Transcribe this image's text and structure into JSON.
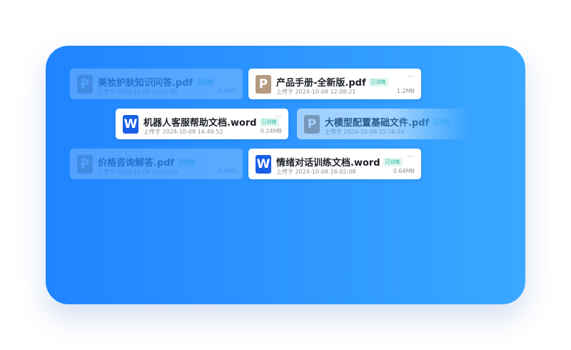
{
  "cards": [
    {
      "name": "美妆护肤知识问答.pdf",
      "badge": "已训练",
      "uploaded": "上传于 2024-10-08 12:32:46",
      "size": "0.8MB",
      "icon_letter": "P",
      "icon": "pdf-file-icon"
    },
    {
      "name": "产品手册-全新版.pdf",
      "badge": "已训练",
      "uploaded": "上传于 2024-10-08 12:08:21",
      "size": "1.2MB",
      "icon_letter": "P",
      "icon": "pdf-file-icon"
    },
    {
      "name": "机器人客服帮助文档.word",
      "badge": "已训练",
      "uploaded": "上传于 2024-10-08 14:49:52",
      "size": "0.24MB",
      "icon_letter": "W",
      "icon": "word-file-icon"
    },
    {
      "name": "大模型配置基础文件.pdf",
      "badge": "已训练",
      "uploaded": "上传于 2024-10-08 15:26:24",
      "size": "",
      "icon_letter": "P",
      "icon": "pdf-file-icon"
    },
    {
      "name": "价格咨询解答.pdf",
      "badge": "已训练",
      "uploaded": "上传于 2024-10-08 15:32:20",
      "size": "0.4MB",
      "icon_letter": "P",
      "icon": "pdf-file-icon"
    },
    {
      "name": "情绪对话训练文档.word",
      "badge": "已训练",
      "uploaded": "上传于 2024-10-08 16:02:08",
      "size": "0.64MB",
      "icon_letter": "W",
      "icon": "word-file-icon"
    }
  ],
  "more_glyph": "···",
  "colors": {
    "panel_start": "#1f84ff",
    "panel_end": "#3aa8ff",
    "pdf_icon": "#b49a80",
    "word_icon": "#1a5ee8",
    "badge_text": "#1fb39a"
  }
}
